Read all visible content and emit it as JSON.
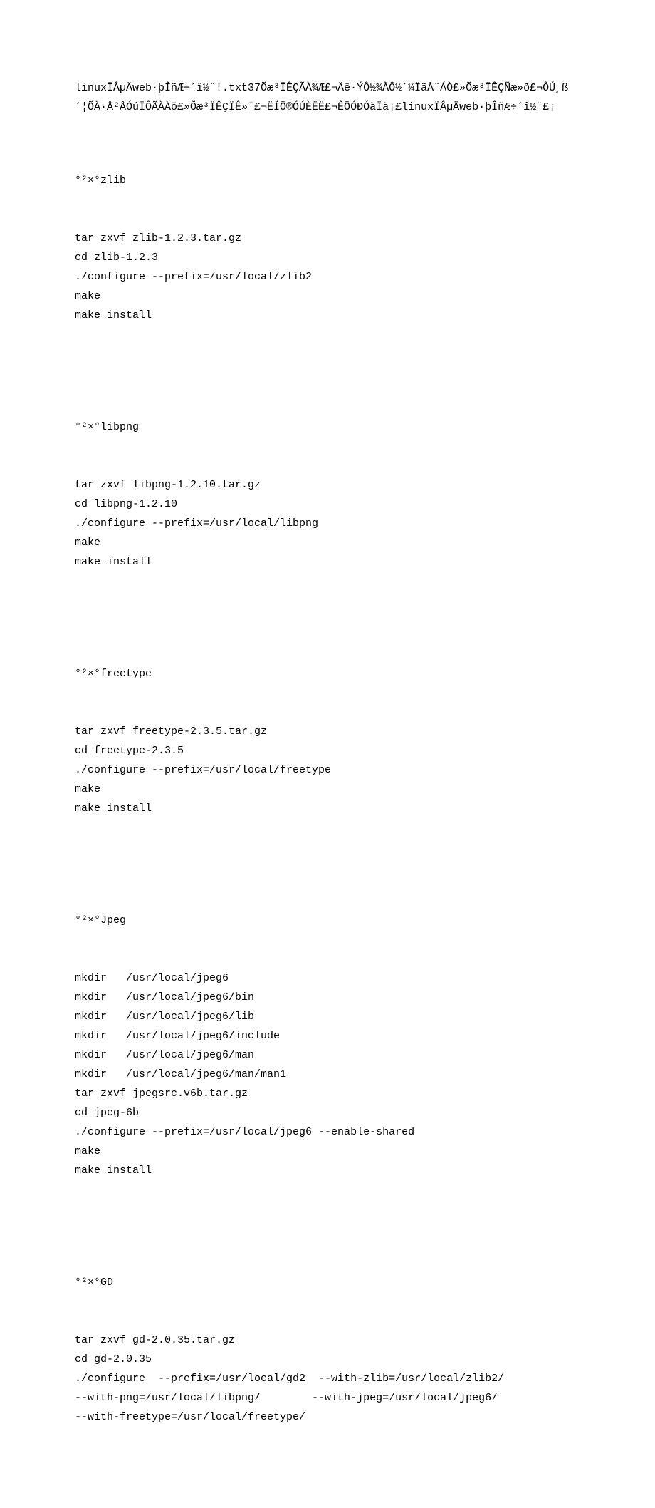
{
  "intro": "linuxÏÂµÄweb·þÎñÆ÷´î½¨!.txt37Õæ³ÏÊÇÃÀ¾Æ£¬Äê·ÝÔ½¾ÃÔ½´¼ÏãÅ¨ÁÒ£»Õæ³ÏÊÇÑæ»ð£¬ÔÚ¸ß´¦ÕÀ·Å²ÅÓúÏÔÃÀÀö£»Õæ³ÏÊÇÏÊ»¨£¬ËÍÖ®ÓÚÈËË£¬ÊÖÓÐÓàÏã¡£linuxÏÂµÄweb·þÎñÆ÷´î½¨£¡",
  "sections": [
    {
      "title": "°²×°zlib",
      "body": "tar zxvf zlib-1.2.3.tar.gz\ncd zlib-1.2.3\n./configure --prefix=/usr/local/zlib2\nmake\nmake install"
    },
    {
      "title": "°²×°libpng",
      "body": "tar zxvf libpng-1.2.10.tar.gz\ncd libpng-1.2.10\n./configure --prefix=/usr/local/libpng\nmake\nmake install"
    },
    {
      "title": "°²×°freetype",
      "body": "tar zxvf freetype-2.3.5.tar.gz\ncd freetype-2.3.5\n./configure --prefix=/usr/local/freetype\nmake\nmake install"
    },
    {
      "title": "°²×°Jpeg",
      "body": "mkdir   /usr/local/jpeg6\nmkdir   /usr/local/jpeg6/bin\nmkdir   /usr/local/jpeg6/lib\nmkdir   /usr/local/jpeg6/include\nmkdir   /usr/local/jpeg6/man\nmkdir   /usr/local/jpeg6/man/man1\ntar zxvf jpegsrc.v6b.tar.gz\ncd jpeg-6b\n./configure --prefix=/usr/local/jpeg6 --enable-shared\nmake\nmake install"
    },
    {
      "title": "°²×°GD",
      "body": "tar zxvf gd-2.0.35.tar.gz\ncd gd-2.0.35\n./configure  --prefix=/usr/local/gd2  --with-zlib=/usr/local/zlib2/\n--with-png=/usr/local/libpng/        --with-jpeg=/usr/local/jpeg6/\n--with-freetype=/usr/local/freetype/"
    }
  ]
}
